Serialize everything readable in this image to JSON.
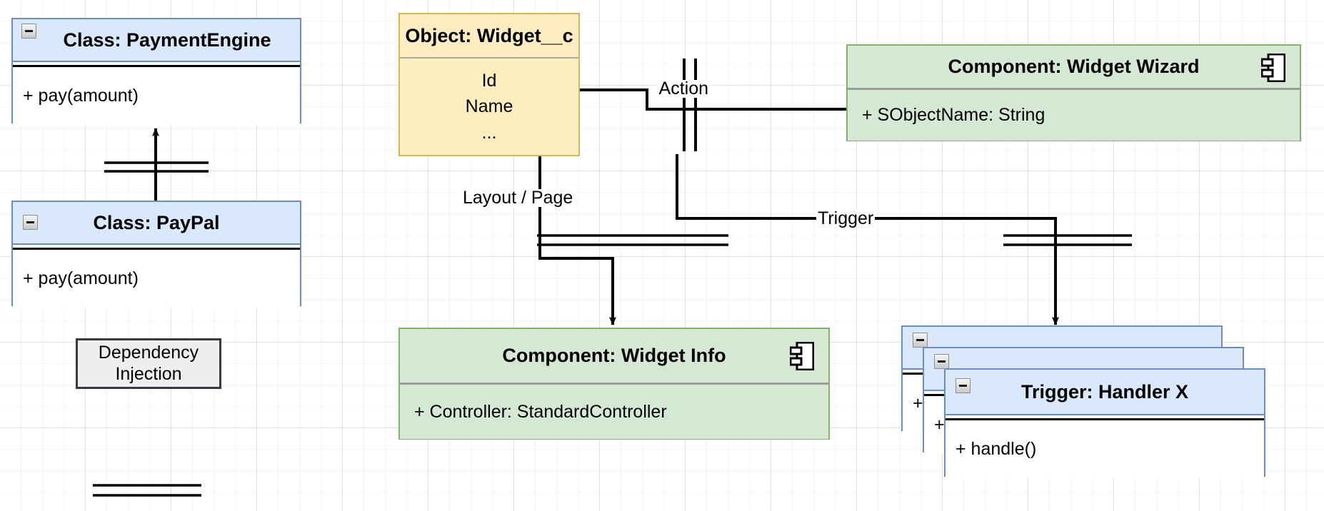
{
  "diagram": {
    "title": "Salesforce metadata UML diagram",
    "colors": {
      "class_fill": "#dae8fc",
      "class_stroke": "#6c8ebf",
      "object_fill": "#fdeec0",
      "object_stroke": "#d6b656",
      "component_fill": "#d5e8d4",
      "component_stroke": "#82b366",
      "note_fill": "#eeeeee",
      "note_stroke": "#36393d",
      "edge": "#000000",
      "canvas": "#ffffff",
      "grid": "#e6e6e6"
    }
  },
  "nodes": {
    "payment_engine": {
      "title": "Class: PaymentEngine",
      "attributes": [
        "+ pay(amount)"
      ],
      "collapse_icon": "minus-icon"
    },
    "paypal": {
      "title": "Class: PayPal",
      "attributes": [
        "+ pay(amount)"
      ],
      "collapse_icon": "minus-icon"
    },
    "widget_object": {
      "title": "Object: Widget__c",
      "attributes": [
        "Id",
        "Name",
        "..."
      ]
    },
    "widget_wizard": {
      "title": "Component: Widget Wizard",
      "attributes": [
        "+ SObjectName: String"
      ],
      "glyph": "component-icon"
    },
    "widget_info": {
      "title": "Component: Widget Info",
      "attributes": [
        "+ Controller: StandardController"
      ],
      "glyph": "component-icon"
    },
    "trigger_handler": {
      "title": "Trigger: Handler X",
      "attributes": [
        "+ handle()"
      ],
      "collapse_icon": "minus-icon",
      "stack_count": 3
    }
  },
  "notes": {
    "dependency_injection": {
      "line1": "Dependency",
      "line2": "Injection"
    }
  },
  "edges": {
    "action": {
      "label": "Action"
    },
    "layout_page": {
      "label": "Layout  / Page"
    },
    "trigger": {
      "label": "Trigger"
    },
    "inheritance": {
      "label": ""
    }
  }
}
